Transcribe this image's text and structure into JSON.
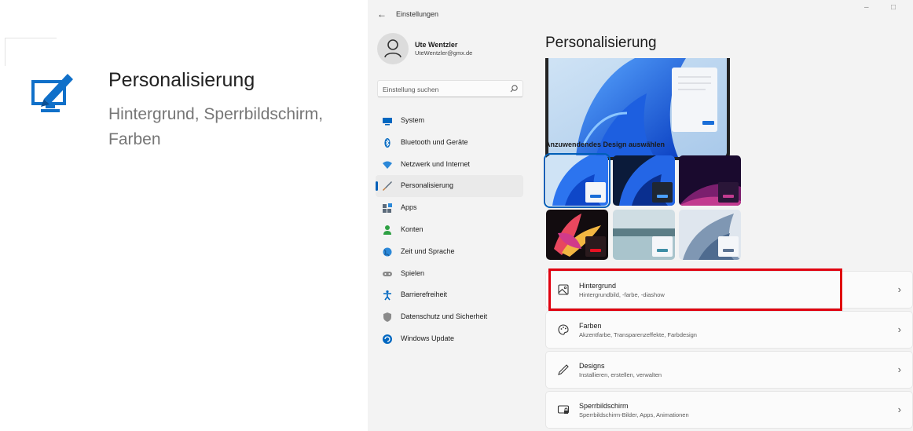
{
  "promo": {
    "icon": "personalize-pen-icon",
    "title": "Personalisierung",
    "subtitle": "Hintergrund, Sperrbildschirm, Farben"
  },
  "window": {
    "back_icon": "back-arrow-icon",
    "back_glyph": "←",
    "app_title": "Einstellungen",
    "minimize_glyph": "–",
    "maximize_glyph": "□",
    "accent_color": "#005fb8"
  },
  "user": {
    "name": "Ute Wentzler",
    "email": "UteWentzler@gmx.de",
    "avatar_icon": "person-icon"
  },
  "search": {
    "placeholder": "Einstellung suchen",
    "icon": "search-icon"
  },
  "nav": {
    "items": [
      {
        "label": "System",
        "icon": "system-monitor-icon",
        "color": "#0067c0"
      },
      {
        "label": "Bluetooth und Geräte",
        "icon": "bluetooth-icon",
        "color": "#0067c0"
      },
      {
        "label": "Netzwerk und Internet",
        "icon": "wifi-icon",
        "color": "#2b88d8"
      },
      {
        "label": "Personalisierung",
        "icon": "brush-icon",
        "color": "#c17a3a",
        "active": true
      },
      {
        "label": "Apps",
        "icon": "apps-icon",
        "color": "#5b6a7a"
      },
      {
        "label": "Konten",
        "icon": "account-icon",
        "color": "#2ea043"
      },
      {
        "label": "Zeit und Sprache",
        "icon": "globe-clock-icon",
        "color": "#2b88d8"
      },
      {
        "label": "Spielen",
        "icon": "gamepad-icon",
        "color": "#7a7a7a"
      },
      {
        "label": "Barrierefreiheit",
        "icon": "accessibility-icon",
        "color": "#0067c0"
      },
      {
        "label": "Datenschutz und Sicherheit",
        "icon": "shield-icon",
        "color": "#7a7a7a"
      },
      {
        "label": "Windows Update",
        "icon": "windows-update-icon",
        "color": "#0067c0"
      }
    ]
  },
  "main": {
    "title": "Personalisierung",
    "design_heading": "Anzuwendendes Design auswählen",
    "themes": [
      {
        "name": "windows-light-bloom",
        "selected": true
      },
      {
        "name": "windows-dark-bloom",
        "selected": false
      },
      {
        "name": "glow-purple",
        "selected": false
      },
      {
        "name": "captured-motion-flower",
        "selected": false
      },
      {
        "name": "sunrise-lake",
        "selected": false
      },
      {
        "name": "flow-blue-grey",
        "selected": false
      }
    ],
    "cards": [
      {
        "title": "Hintergrund",
        "subtitle": "Hintergrundbild, -farbe, -diashow",
        "icon": "image-icon",
        "highlighted": true
      },
      {
        "title": "Farben",
        "subtitle": "Akzentfarbe, Transparenzeffekte, Farbdesign",
        "icon": "palette-icon"
      },
      {
        "title": "Designs",
        "subtitle": "Installieren, erstellen, verwalten",
        "icon": "pen-icon"
      },
      {
        "title": "Sperrbildschirm",
        "subtitle": "Sperrbildschirm-Bilder, Apps, Animationen",
        "icon": "lock-screen-icon"
      }
    ],
    "chevron_glyph": "›"
  }
}
